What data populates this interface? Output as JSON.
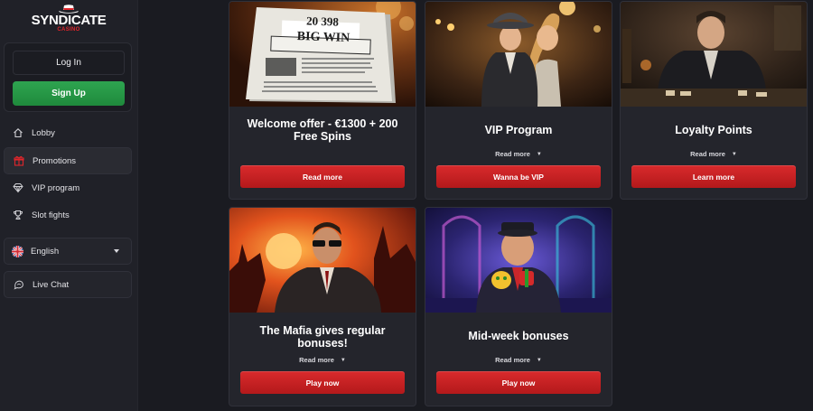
{
  "brand": {
    "name": "SYNDICATE",
    "sub": "CASINO"
  },
  "auth": {
    "login_label": "Log In",
    "signup_label": "Sign Up"
  },
  "nav": [
    {
      "label": "Lobby",
      "icon": "home-icon"
    },
    {
      "label": "Promotions",
      "icon": "gift-icon",
      "active": true
    },
    {
      "label": "VIP program",
      "icon": "diamond-icon"
    },
    {
      "label": "Slot fights",
      "icon": "trophy-icon"
    }
  ],
  "language": {
    "label": "English",
    "flag": "uk-flag-icon"
  },
  "chat": {
    "label": "Live Chat"
  },
  "cards": [
    {
      "title": "Welcome offer - €1300 + 200 Free Spins",
      "readmore": "",
      "cta": "Read more",
      "image_text": {
        "number": "20 398",
        "headline": "BIG WIN"
      }
    },
    {
      "title": "VIP Program",
      "readmore": "Read more",
      "cta": "Wanna be VIP"
    },
    {
      "title": "Loyalty Points",
      "readmore": "Read more",
      "cta": "Learn more"
    },
    {
      "title": "The Mafia gives regular bonuses!",
      "readmore": "Read more",
      "cta": "Play now"
    },
    {
      "title": "Mid-week bonuses",
      "readmore": "Read more",
      "cta": "Play now"
    }
  ],
  "colors": {
    "accent_red": "#c8201f",
    "signup_green": "#27963f",
    "background": "#1a1b21",
    "card": "#24252c"
  }
}
